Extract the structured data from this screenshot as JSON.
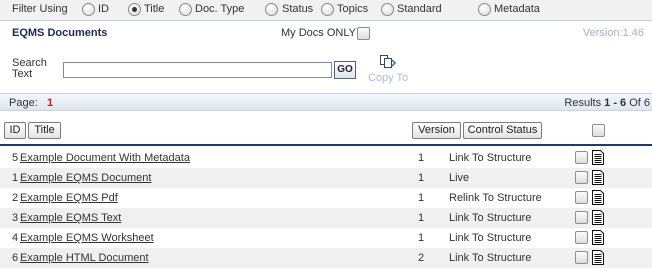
{
  "filter": {
    "label": "Filter Using",
    "options": [
      {
        "label": "ID",
        "checked": false
      },
      {
        "label": "Title",
        "checked": true
      },
      {
        "label": "Doc. Type",
        "checked": false
      },
      {
        "label": "Status",
        "checked": false
      },
      {
        "label": "Topics",
        "checked": false
      },
      {
        "label": "Standard",
        "checked": false
      },
      {
        "label": "Metadata",
        "checked": false
      }
    ]
  },
  "header": {
    "title": "EQMS Documents",
    "my_docs_label": "My Docs ONLY",
    "version": "Version:1.46"
  },
  "search": {
    "label": "Search Text",
    "value": "",
    "go_label": "GO",
    "copy_to_label": "Copy To"
  },
  "pager": {
    "page_label": "Page:",
    "page_number": "1",
    "results_prefix": "Results ",
    "results_range": "1 - 6",
    "results_suffix": " Of 6"
  },
  "columns": {
    "id": "ID",
    "title": "Title",
    "version": "Version",
    "status": "Control Status"
  },
  "rows": [
    {
      "id": "5",
      "title": "Example Document With Metadata",
      "version": "1",
      "status": "Link To Structure"
    },
    {
      "id": "1",
      "title": "Example EQMS Document",
      "version": "1",
      "status": "Live"
    },
    {
      "id": "2",
      "title": "Example EQMS Pdf",
      "version": "1",
      "status": "Relink To Structure"
    },
    {
      "id": "3",
      "title": "Example EQMS Text",
      "version": "1",
      "status": "Link To Structure"
    },
    {
      "id": "4",
      "title": "Example EQMS Worksheet",
      "version": "1",
      "status": "Link To Structure"
    },
    {
      "id": "6",
      "title": "Example HTML Document",
      "version": "2",
      "status": "Link To Structure"
    }
  ]
}
